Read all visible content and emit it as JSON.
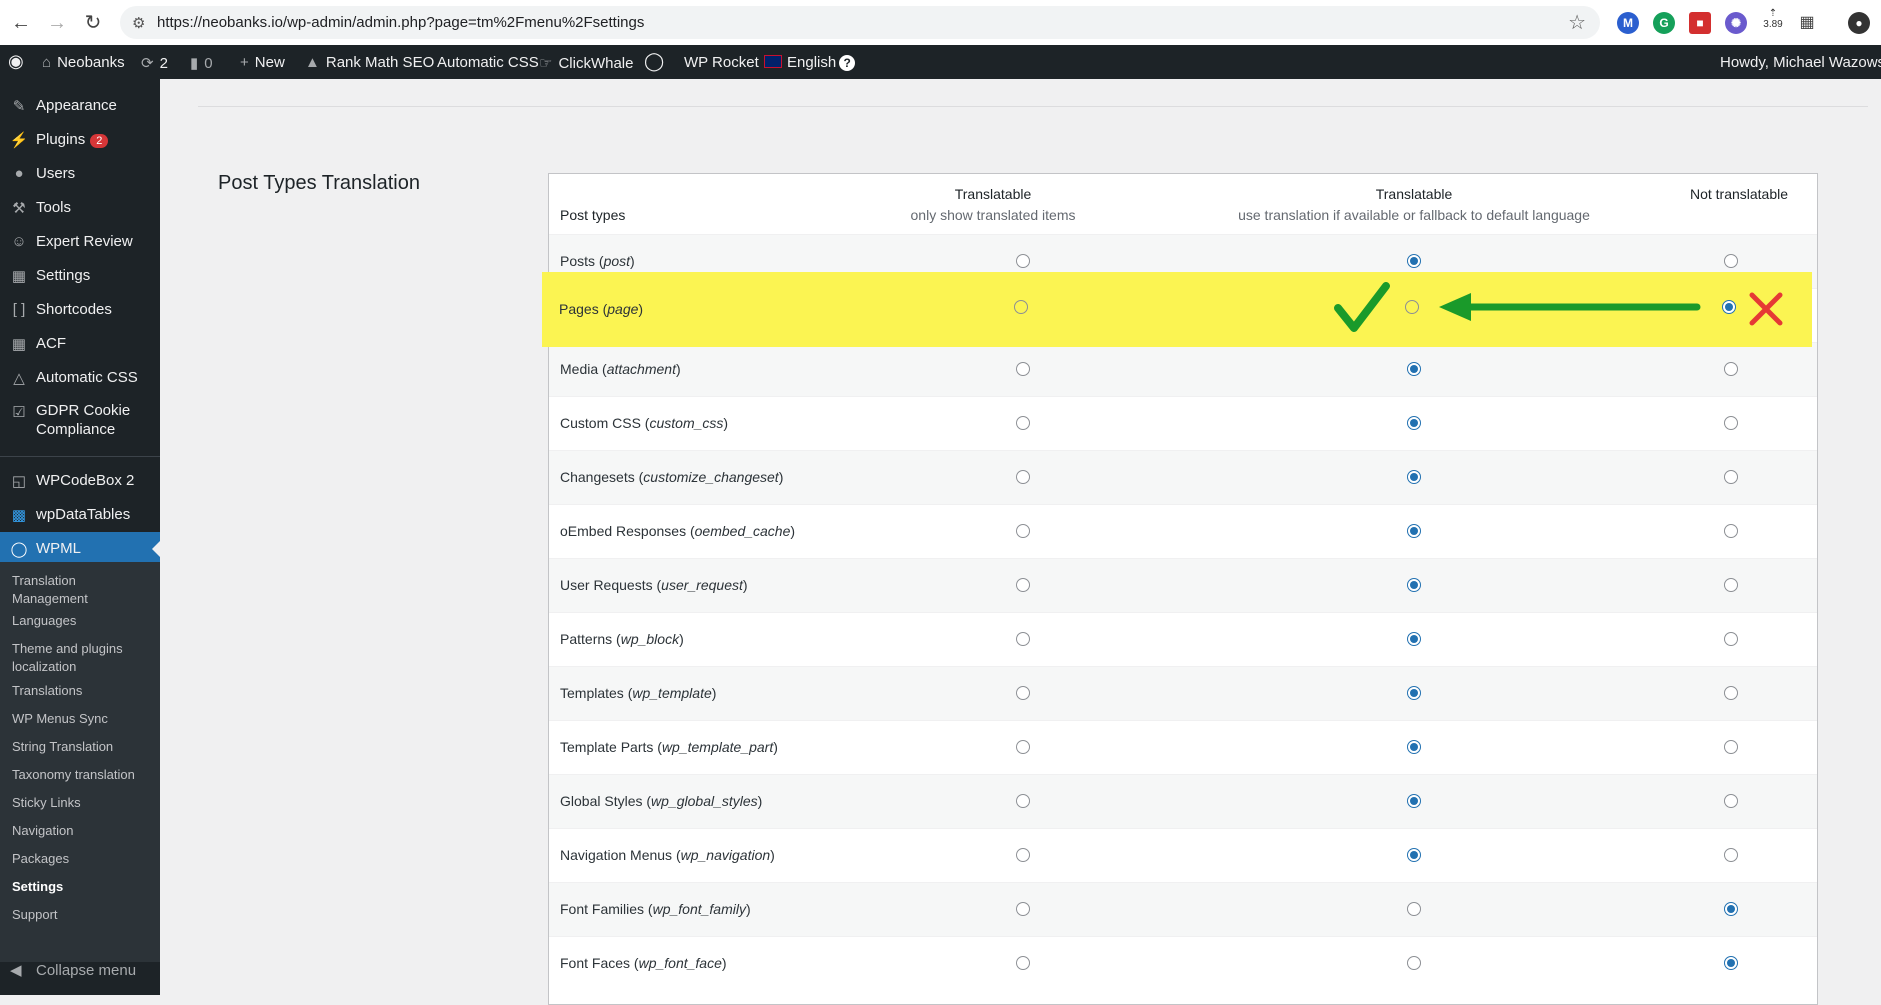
{
  "browser": {
    "url": "https://neobanks.io/wp-admin/admin.php?page=tm%2Fmenu%2Fsettings",
    "extension_badge": "3.89"
  },
  "adminbar": {
    "site_name": "Neobanks",
    "updates_count": "2",
    "comments_count": "0",
    "new_label": "New",
    "rank_math": "Rank Math SEO",
    "automatic_css": "Automatic CSS",
    "clickwhale": "ClickWhale",
    "wp_rocket": "WP Rocket",
    "language": "English",
    "howdy": "Howdy, Michael Wazowski"
  },
  "sidebar": {
    "items": [
      {
        "label": "Appearance",
        "icon": "paintbrush-icon"
      },
      {
        "label": "Plugins",
        "icon": "plugin-icon",
        "badge": "2"
      },
      {
        "label": "Users",
        "icon": "users-icon"
      },
      {
        "label": "Tools",
        "icon": "wrench-icon"
      },
      {
        "label": "Expert Review",
        "icon": "person-icon"
      },
      {
        "label": "Settings",
        "icon": "settings-icon"
      },
      {
        "label": "Shortcodes",
        "icon": "brackets-icon"
      },
      {
        "label": "ACF",
        "icon": "table-icon"
      },
      {
        "label": "Automatic CSS",
        "icon": "triangle-icon"
      },
      {
        "label": "GDPR Cookie",
        "label2": "Compliance",
        "icon": "checkbox-icon"
      },
      {
        "label": "WPCodeBox 2",
        "icon": "codebox-icon"
      },
      {
        "label": "wpDataTables",
        "icon": "datatables-icon"
      },
      {
        "label": "WPML",
        "icon": "wpml-icon"
      }
    ],
    "submenu": [
      {
        "label": "Translation Management"
      },
      {
        "label": "Languages"
      },
      {
        "label": "Theme and plugins localization"
      },
      {
        "label": "Translations"
      },
      {
        "label": "WP Menus Sync"
      },
      {
        "label": "String Translation"
      },
      {
        "label": "Taxonomy translation"
      },
      {
        "label": "Sticky Links"
      },
      {
        "label": "Navigation"
      },
      {
        "label": "Packages"
      },
      {
        "label": "Settings"
      },
      {
        "label": "Support"
      }
    ],
    "collapse": "Collapse menu"
  },
  "section_title": "Post Types Translation",
  "table": {
    "col0": "Post types",
    "col1_title": "Translatable",
    "col1_sub": "only show translated items",
    "col2_title": "Translatable",
    "col2_sub": "use translation if available or fallback to default language",
    "col3_title": "Not translatable",
    "rows": [
      {
        "name": "Posts",
        "slug": "post",
        "selected": 2
      },
      {
        "name": "Pages",
        "slug": "page",
        "selected": 3
      },
      {
        "name": "Media",
        "slug": "attachment",
        "selected": 2
      },
      {
        "name": "Custom CSS",
        "slug": "custom_css",
        "selected": 2
      },
      {
        "name": "Changesets",
        "slug": "customize_changeset",
        "selected": 2
      },
      {
        "name": "oEmbed Responses",
        "slug": "oembed_cache",
        "selected": 2
      },
      {
        "name": "User Requests",
        "slug": "user_request",
        "selected": 2
      },
      {
        "name": "Patterns",
        "slug": "wp_block",
        "selected": 2
      },
      {
        "name": "Templates",
        "slug": "wp_template",
        "selected": 2
      },
      {
        "name": "Template Parts",
        "slug": "wp_template_part",
        "selected": 2
      },
      {
        "name": "Global Styles",
        "slug": "wp_global_styles",
        "selected": 2
      },
      {
        "name": "Navigation Menus",
        "slug": "wp_navigation",
        "selected": 2
      },
      {
        "name": "Font Families",
        "slug": "wp_font_family",
        "selected": 3
      },
      {
        "name": "Font Faces",
        "slug": "wp_font_face",
        "selected": 3
      }
    ]
  },
  "annotation": {
    "highlight_color": "#fbf452",
    "check_color": "#1a9a2a",
    "arrow_color": "#1a9a2a",
    "cross_color": "#e53935"
  }
}
